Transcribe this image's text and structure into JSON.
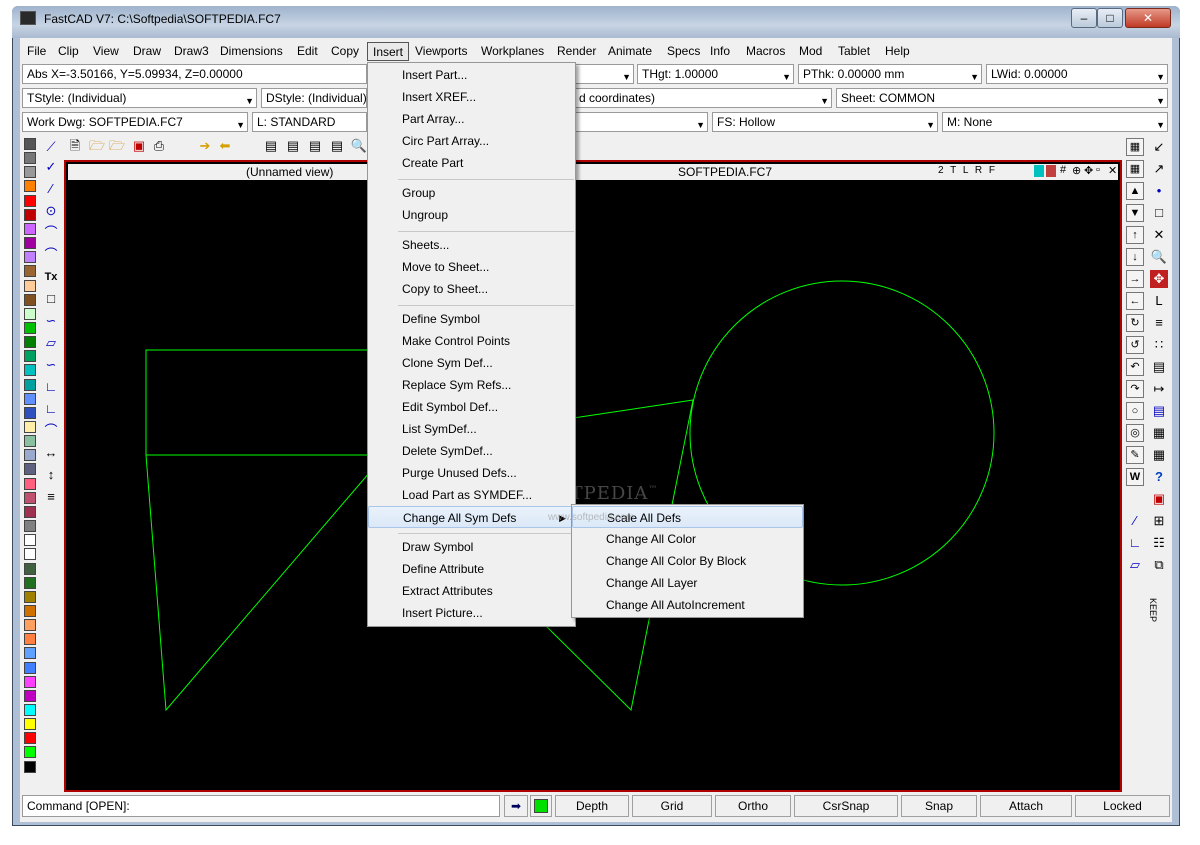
{
  "window": {
    "title": "FastCAD V7: C:\\Softpedia\\SOFTPEDIA.FC7",
    "min": "0",
    "max": "1",
    "close": "r"
  },
  "menubar": [
    "File",
    "Clip",
    "View",
    "Draw",
    "Draw3",
    "Dimensions",
    "Edit",
    "Copy",
    "Insert",
    "Viewports",
    "Workplanes",
    "Render",
    "Animate",
    "Specs",
    "Info",
    "Macros",
    "Mod",
    "Tablet",
    "Help"
  ],
  "row1": {
    "coords": "Abs X=-3.50166, Y=5.09934, Z=0.00000",
    "thgt": "THgt: 1.00000",
    "pthk": "PThk: 0.00000 mm",
    "lwid": "LWid: 0.00000"
  },
  "row2": {
    "tstyle": "TStyle: (Individual)",
    "dstyle": "DStyle: (Individual)",
    "coordmode": "d coordinates)",
    "sheet": "Sheet: COMMON"
  },
  "row3": {
    "workdwg": "Work Dwg: SOFTPEDIA.FC7",
    "layer": "L: STANDARD",
    "fs": "FS: Hollow",
    "m": "M: None"
  },
  "canvas": {
    "view_name": "(Unnamed view)",
    "file": "SOFTPEDIA.FC7",
    "view_tools": "2 T L R F"
  },
  "insert_menu": {
    "group1": [
      "Insert Part...",
      "Insert XREF...",
      "Part Array...",
      "Circ Part Array...",
      "Create Part"
    ],
    "group2": [
      "Group",
      "Ungroup"
    ],
    "group3": [
      "Sheets...",
      "Move to Sheet...",
      "Copy to Sheet..."
    ],
    "group4": [
      "Define Symbol",
      "Make Control Points",
      "Clone Sym Def...",
      "Replace Sym Refs...",
      "Edit Symbol Def...",
      "List SymDef...",
      "Delete SymDef...",
      "Purge Unused Defs...",
      "Load Part as SYMDEF...",
      "Change All Sym Defs"
    ],
    "group5": [
      "Draw Symbol",
      "Define Attribute",
      "Extract Attributes",
      "Insert Picture..."
    ]
  },
  "submenu": [
    "Scale All Defs",
    "Change All Color",
    "Change All Color By Block",
    "Change All Layer",
    "Change All AutoIncrement"
  ],
  "statusbar": {
    "command": "Command [OPEN]:",
    "buttons": [
      "Depth",
      "Grid",
      "Ortho",
      "CsrSnap",
      "Snap",
      "Attach",
      "Locked"
    ]
  },
  "right_tool": {
    "keep": "KEEP",
    "text_tool": "Tx",
    "help": "?",
    "w": "W",
    "l": "L"
  },
  "watermark": {
    "main": "SOFTPEDIA",
    "tm": "™",
    "sub": "www.softpedia.com"
  },
  "colors": {
    "canvas": "#000000",
    "geometry": "#00ff00",
    "frame": "#b00000",
    "menu_hl": "#dbe8f7"
  },
  "palette": [
    "#555555",
    "#777777",
    "#999999",
    "#ff8000",
    "#ff0000",
    "#c00000",
    "#cc66ff",
    "#a000a0",
    "#c080ff",
    "#996633",
    "#ffcc99",
    "#805020",
    "#ccffcc",
    "#00c000",
    "#008000",
    "#00a060",
    "#00c0c0",
    "#00a0a0",
    "#6090ff",
    "#3050c0",
    "#ffeeaa",
    "#88c0a0",
    "#9aaacc",
    "#606080",
    "#ff6080",
    "#c05070",
    "#a03050",
    "#808080",
    "#ffffff",
    "#ffffff",
    "#406040",
    "#207020",
    "#a08000",
    "#d07000",
    "#ffa060",
    "#ff8040",
    "#60a0ff",
    "#4080ff",
    "#ff40ff",
    "#c000c0",
    "#00ffff",
    "#ffff00",
    "#ff0000",
    "#00ff00",
    "#000000"
  ]
}
